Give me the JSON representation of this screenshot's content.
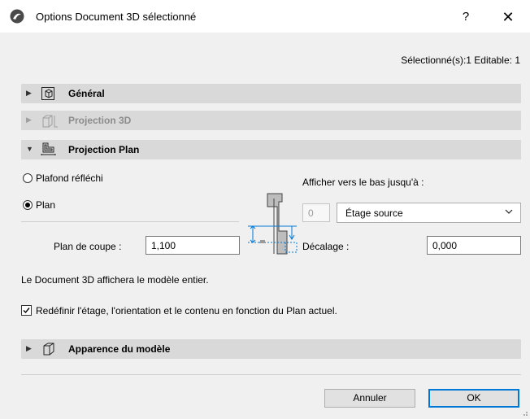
{
  "window": {
    "title": "Options Document 3D sélectionné",
    "help_label": "?",
    "close_label": "✕"
  },
  "selection_info": "Sélectionné(s):1 Editable: 1",
  "sections": {
    "general": {
      "label": "Général",
      "expanded": false
    },
    "projection3d": {
      "label": "Projection 3D",
      "expanded": false,
      "disabled": true
    },
    "projection_plan": {
      "label": "Projection Plan",
      "expanded": true
    },
    "appearance": {
      "label": "Apparence du modèle",
      "expanded": false
    }
  },
  "projection_plan": {
    "radio_options": [
      {
        "label": "Plafond réfléchi",
        "selected": false
      },
      {
        "label": "Plan",
        "selected": true
      }
    ],
    "show_down_label": "Afficher vers le bas jusqu'à :",
    "level_value": "0",
    "story_select": "Étage source",
    "cut_plane_label": "Plan de coupe :",
    "cut_plane_value": "1,100",
    "offset_label": "Décalage :",
    "offset_value": "0,000"
  },
  "info_text": "Le Document 3D affichera le modèle entier.",
  "redefine_checkbox": {
    "checked": true,
    "label": "Redéfinir l'étage, l'orientation et le contenu en fonction du Plan actuel."
  },
  "buttons": {
    "cancel": "Annuler",
    "ok": "OK"
  },
  "colors": {
    "section_bg": "#d9d9d9",
    "accent": "#0078d7",
    "dialog_bg": "#f0f0f0"
  }
}
